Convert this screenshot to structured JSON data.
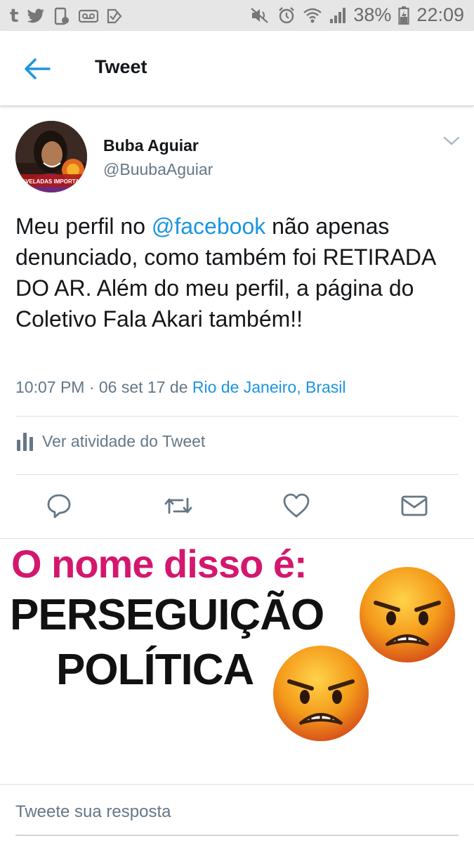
{
  "status_bar": {
    "app_icons": [
      "tumblr-icon",
      "twitter-icon",
      "phone-icon",
      "voicemail-icon",
      "check-icon"
    ],
    "battery": "38%",
    "time": "22:09"
  },
  "header": {
    "title": "Tweet"
  },
  "tweet": {
    "author_name": "Buba Aguiar",
    "author_handle": "@BuubaAguiar",
    "avatar_badge": "FAVELADAS IMPORTAM",
    "text_before": "Meu perfil no ",
    "mention": "@facebook",
    "text_after": " não apenas denunciado, como também foi RETIRADA DO AR. Além do meu perfil, a página do Coletivo Fala Akari também!!",
    "time": "10:07 PM · 06 set 17",
    "location_prefix": "de",
    "location": "Rio de Janeiro, Brasil",
    "activity_label": "Ver atividade do Tweet"
  },
  "image_caption": {
    "line1": "O nome disso é:",
    "line2": "PERSEGUIÇÃO",
    "line3": "POLÍTICA",
    "line1_color": "#d4176e"
  },
  "reply": {
    "placeholder": "Tweete sua resposta"
  },
  "colors": {
    "accent": "#1b95e0",
    "secondary_text": "#657786",
    "status_bar_bg": "#e6e6e6"
  }
}
